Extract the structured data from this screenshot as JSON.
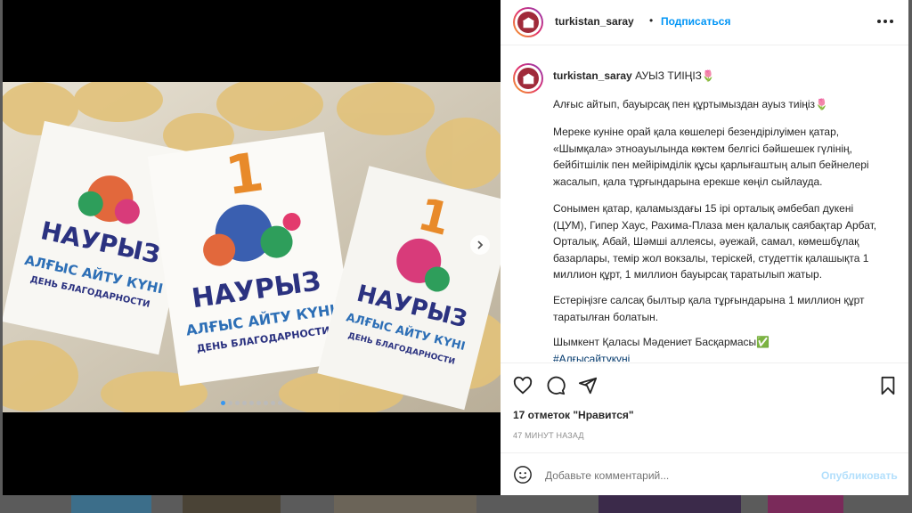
{
  "post": {
    "username": "turkistan_saray",
    "follow_label": "Подписаться",
    "caption_title": "АУЫЗ ТИІҢІЗ🌷",
    "caption_lines": [
      "Алғыс айтып, бауырсақ пен құртымыздан ауыз тиіңіз🌷",
      "Мереке куніне орай қала көшелері безендірілуімен қатар,",
      "«Шымқала» этноауылында көктем белгісі бәйшешек гүлінің,",
      "бейбітшілік пен мейірімділік құсы қарлығаштың алып бейнелері",
      "жасалып, қала тұрғындарына ерекше көңіл сыйлауда.",
      "Сонымен қатар, қаламыздағы 15 ірі орталық әмбебап дукені",
      "(ЦУМ), Гипер Хаус, Рахима-Плаза мен қалалық саябақтар Арбат,",
      "Орталық, Абай, Шәмші аллеясы, әуежай, самал, көмешбұлақ",
      "базарлары, темір жол вокзалы, терiскей, студеттік қалашықта 1",
      "миллион құрт, 1 миллион бауырсақ таратылып жатыр.",
      "Естеріңізге салсақ былтыр қала тұрғындарына 1 миллион құрт",
      "таратылған болатын.",
      "Шымкент Қаласы Мәдениет Басқармасы✅",
      "#Алғысайтукүні"
    ],
    "likes_text": "17 отметок \"Нравится\"",
    "time_ago": "47 МИНУТ НАЗАД",
    "comment_placeholder": "Добавьте комментарий...",
    "publish_label": "Опубликовать",
    "more_options": "...",
    "slide_count": 9,
    "current_slide": 0,
    "photo_text": {
      "holiday": "НАУРЫЗ",
      "line_kz": "АЛҒЫС АЙТУ КҮНІ",
      "line_ru": "ДЕНЬ БЛАГОДАРНОСТИ",
      "number": "1"
    }
  },
  "icons": [
    "heart-icon",
    "comment-icon",
    "share-icon",
    "bookmark-icon",
    "emoji-icon",
    "more-icon",
    "next-arrow-icon"
  ],
  "colors": {
    "accent": "#0095f6",
    "publish_disabled": "#b2dffc",
    "divider": "#efefef"
  }
}
